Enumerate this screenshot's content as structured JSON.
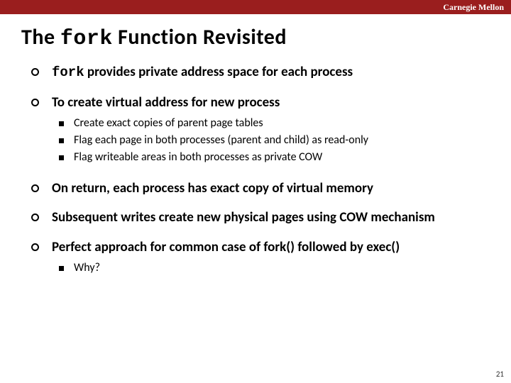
{
  "header": {
    "institution": "Carnegie Mellon"
  },
  "title": {
    "prefix": "The ",
    "code": "fork",
    "suffix": " Function Revisited"
  },
  "bullets": [
    {
      "text_before_code": "",
      "code": "fork",
      "text_after_code": " provides private address space for each process",
      "subs": []
    },
    {
      "text_before_code": "To create virtual address for new process",
      "code": "",
      "text_after_code": "",
      "subs": [
        "Create exact copies of parent page tables",
        "Flag each page in both processes (parent and child) as read-only",
        "Flag writeable areas in both processes as private COW"
      ]
    },
    {
      "text_before_code": "On return, each process has exact copy of virtual memory",
      "code": "",
      "text_after_code": "",
      "subs": []
    },
    {
      "text_before_code": "Subsequent writes create new physical pages using COW mechanism",
      "code": "",
      "text_after_code": "",
      "subs": []
    },
    {
      "text_before_code": "Perfect approach for common case of fork() followed by exec()",
      "code": "",
      "text_after_code": "",
      "subs": [
        "Why?"
      ]
    }
  ],
  "page_number": "21"
}
